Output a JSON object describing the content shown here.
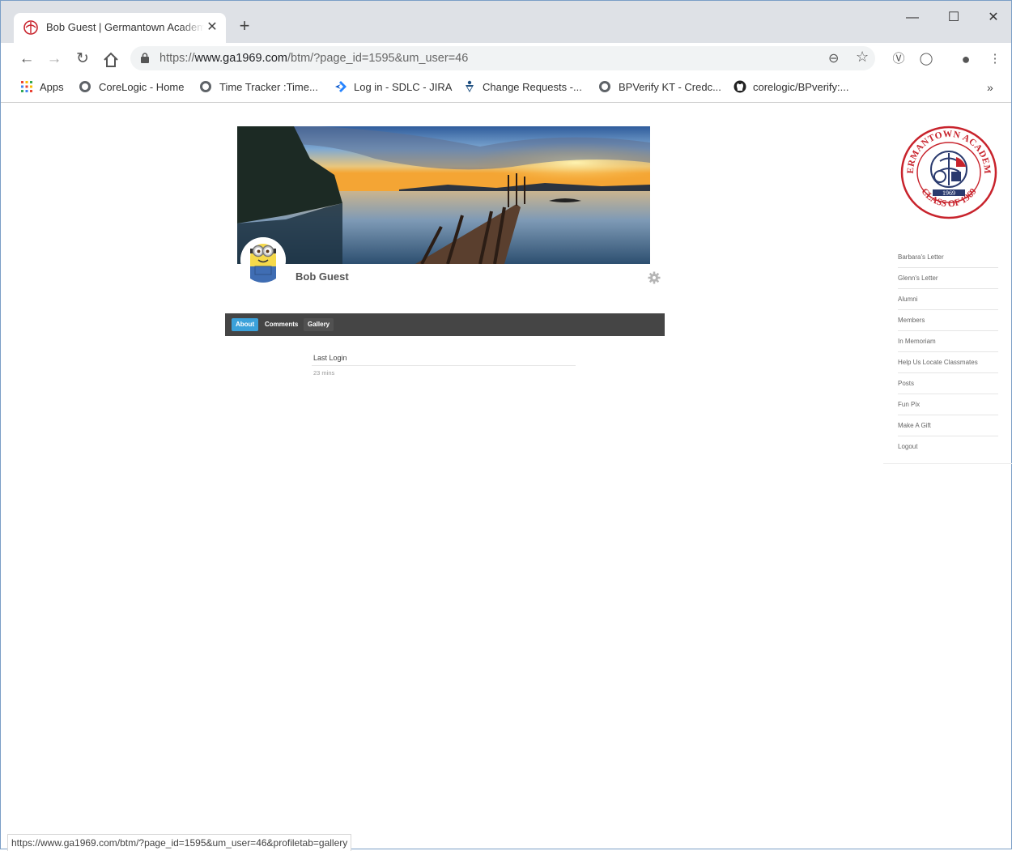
{
  "browser": {
    "tab_title": "Bob Guest | Germantown Academy",
    "close_glyph": "✕",
    "new_tab_glyph": "+",
    "window_controls": {
      "minimize": "—",
      "maximize": "☐",
      "close": "✕"
    },
    "url_scheme": "https://",
    "url_host": "www.ga1969.com",
    "url_path": "/btm/?page_id=1595&um_user=46",
    "bookmarks": [
      {
        "label": "Apps",
        "icon": "apps-grid-icon"
      },
      {
        "label": "CoreLogic - Home",
        "icon": "globe-icon"
      },
      {
        "label": "Time Tracker :Time...",
        "icon": "globe-icon"
      },
      {
        "label": "Log in - SDLC - JIRA",
        "icon": "jira-icon"
      },
      {
        "label": "Change Requests -...",
        "icon": "confluence-icon"
      },
      {
        "label": "BPVerify KT - Credc...",
        "icon": "globe-icon"
      },
      {
        "label": "corelogic/BPverify:...",
        "icon": "github-icon"
      }
    ],
    "bookmarks_overflow": "»",
    "status_url": "https://www.ga1969.com/btm/?page_id=1595&um_user=46&profiletab=gallery"
  },
  "profile": {
    "name": "Bob Guest",
    "tabs": [
      "About",
      "Comments",
      "Gallery"
    ],
    "active_tab": "About",
    "fields": [
      {
        "label": "Last Login",
        "value": "23 mins"
      }
    ]
  },
  "logo": {
    "top_text": "GERMANTOWN ACADEMY",
    "year": "1969",
    "bottom_text": "CLASS OF 1969"
  },
  "sidebar": {
    "items": [
      "Barbara's Letter",
      "Glenn's Letter",
      "Alumni",
      "Members",
      "In Memoriam",
      "Help Us Locate Classmates",
      "Posts",
      "Fun Pix",
      "Make A Gift",
      "Logout"
    ]
  },
  "colors": {
    "tabbar_bg": "#454545",
    "active_tab": "#3ba1da",
    "logo_red": "#c8232c",
    "logo_navy": "#2a3a6e"
  }
}
